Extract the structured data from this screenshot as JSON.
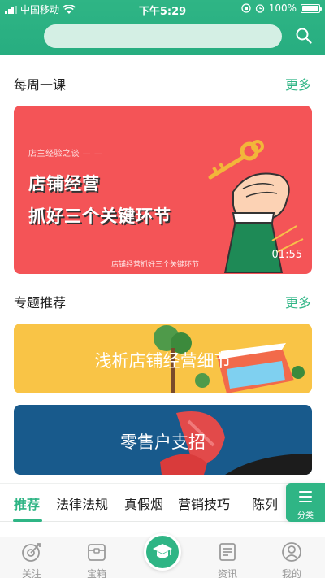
{
  "status_bar": {
    "carrier": "中国移动",
    "time": "下午5:29",
    "battery": "100%"
  },
  "colors": {
    "brand": "#2fb585",
    "video_bg": "#f45457",
    "topic_1_bg": "#f9c446",
    "topic_2_bg": "#185a8c"
  },
  "weekly": {
    "title": "每周一课",
    "more": "更多",
    "video": {
      "small_label": "店主经验之谈 — —",
      "line1": "店铺经营",
      "line2": "抓好三个关键环节",
      "caption": "店铺经营抓好三个关键环节",
      "duration": "01:55"
    }
  },
  "topics": {
    "title": "专题推荐",
    "more": "更多",
    "cards": [
      {
        "label": "浅析店铺经营细节"
      },
      {
        "label": "零售户支招"
      }
    ]
  },
  "category_tabs": {
    "items": [
      {
        "label": "推荐"
      },
      {
        "label": "法律法规"
      },
      {
        "label": "真假烟"
      },
      {
        "label": "营销技巧"
      },
      {
        "label": "陈列"
      }
    ],
    "active_index": 0,
    "category_button": "分类"
  },
  "tabbar": {
    "items": [
      {
        "label": "关注",
        "icon": "target-icon"
      },
      {
        "label": "宝箱",
        "icon": "chest-icon"
      },
      {
        "label": "",
        "icon": "graduation-cap-icon"
      },
      {
        "label": "资讯",
        "icon": "news-icon"
      },
      {
        "label": "我的",
        "icon": "user-icon"
      }
    ]
  }
}
